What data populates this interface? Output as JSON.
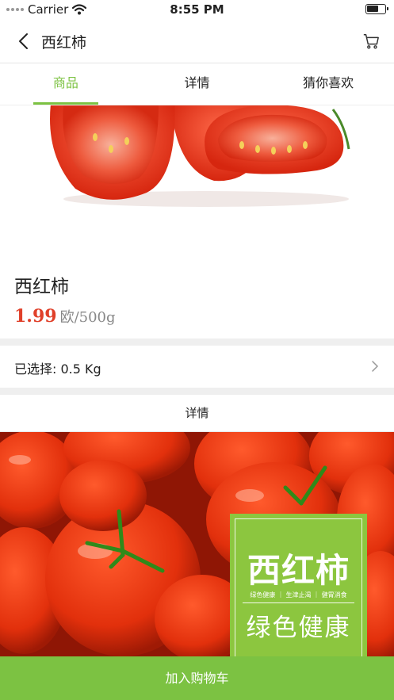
{
  "status": {
    "carrier": "Carrier",
    "time": "8:55 PM"
  },
  "nav": {
    "title": "西红柿"
  },
  "tabs": [
    {
      "label": "商品",
      "active": true
    },
    {
      "label": "详情",
      "active": false
    },
    {
      "label": "猜你喜欢",
      "active": false
    }
  ],
  "product": {
    "name": "西红柿",
    "price": "1.99",
    "unit": "欧/500g"
  },
  "selection": {
    "label": "已选择: 0.5 Kg"
  },
  "detail": {
    "heading": "详情",
    "badge_title": "西红柿",
    "badge_sub": "绿色健康 ｜ 生津止渴 ｜ 健胃消食",
    "badge_slogan": "绿色健康"
  },
  "actions": {
    "add_to_cart": "加入购物车"
  },
  "colors": {
    "accent": "#7cc242",
    "price": "#e0402a"
  }
}
